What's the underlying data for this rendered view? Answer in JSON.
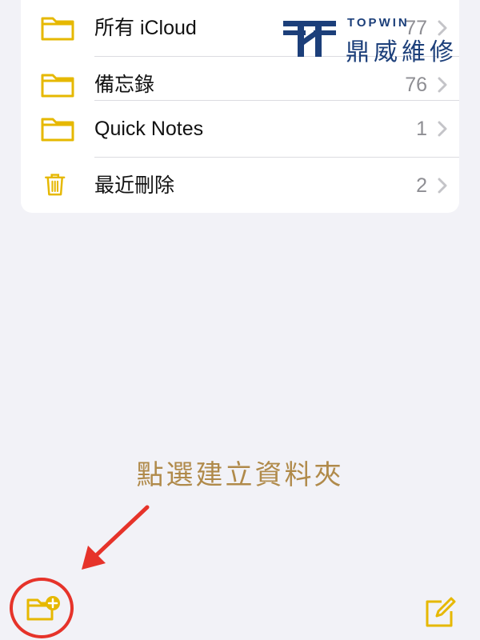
{
  "folders": [
    {
      "name": "所有 iCloud",
      "count": "77",
      "icon": "folder-icon"
    },
    {
      "name": "備忘錄",
      "count": "76",
      "icon": "folder-icon"
    },
    {
      "name": "Quick Notes",
      "count": "1",
      "icon": "folder-icon"
    },
    {
      "name": "最近刪除",
      "count": "2",
      "icon": "trash-icon"
    }
  ],
  "logo": {
    "en": "TOPWIN",
    "zh": "鼎威維修"
  },
  "hint": "點選建立資料夾",
  "colors": {
    "accent": "#e6b800",
    "hint": "#b08a4a",
    "annotation": "#e6332a",
    "logo": "#1c3f7a",
    "background": "#f2f2f7"
  },
  "toolbar": {
    "new_folder_icon": "new-folder-icon",
    "compose_icon": "compose-icon"
  }
}
